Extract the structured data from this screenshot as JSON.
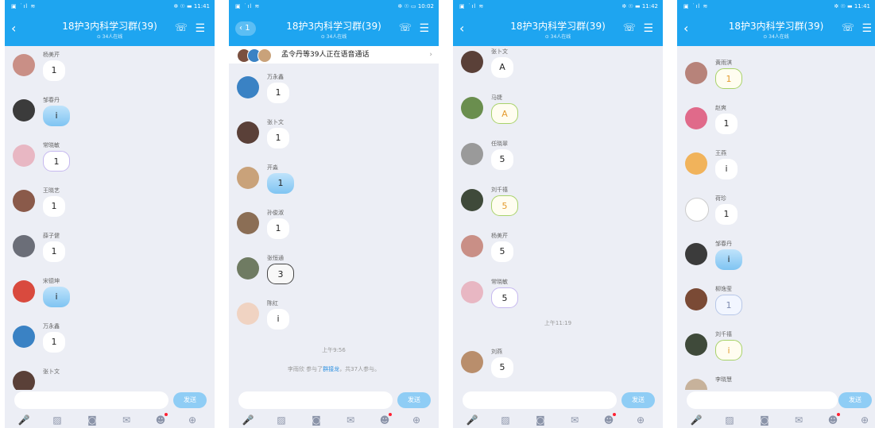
{
  "colors": {
    "header": "#1ea5f0",
    "bg": "#eceef5",
    "send": "#8fcdf5",
    "accent_link": "#2a8fe0"
  },
  "phones": [
    {
      "status_left": "▣ ˙ıl ≋",
      "status_right": "✲ ☉ ▬ 11:41",
      "back_label": "‹",
      "back_count": "",
      "title": "18护3内科学习群(39)",
      "subtitle": "⊙ 34人在线",
      "banner": null,
      "messages": [
        {
          "name": "杨美芹",
          "text": "1",
          "style": "plain",
          "avatar": "#c98f86"
        },
        {
          "name": "邹春丹",
          "text": "i",
          "style": "blue",
          "avatar": "#3b3b3b"
        },
        {
          "name": "常晓敏",
          "text": "1",
          "style": "purple",
          "avatar": "#e8b7c3"
        },
        {
          "name": "王晓艺",
          "text": "1",
          "style": "plain",
          "avatar": "#8a5a4a"
        },
        {
          "name": "薛子健",
          "text": "1",
          "style": "plain",
          "avatar": "#6b6e78"
        },
        {
          "name": "宋德坤",
          "text": "i",
          "style": "blue",
          "avatar": "#d94a3e"
        },
        {
          "name": "万永鑫",
          "text": "1",
          "style": "plain",
          "avatar": "#3a82c4"
        },
        {
          "name": "张卜文",
          "text": "",
          "style": "none",
          "avatar": "#5a4038"
        }
      ],
      "system": [],
      "send_label": "发送"
    },
    {
      "status_left": "▣ ˙ıl ≋",
      "status_right": "✲ ☉ ▭ 10:02",
      "back_label": "‹",
      "back_count": "1",
      "title": "18护3内科学习群(39)",
      "subtitle": "⊙ 34人在线",
      "banner": {
        "text": "孟令丹等39人正在语音通话",
        "chevron": "›"
      },
      "messages": [
        {
          "name": "万永鑫",
          "text": "1",
          "style": "plain",
          "avatar": "#3a82c4"
        },
        {
          "name": "张卜文",
          "text": "1",
          "style": "plain",
          "avatar": "#5a4038"
        },
        {
          "name": "开淼",
          "text": "1",
          "style": "blue",
          "avatar": "#c9a27a"
        },
        {
          "name": "孙俊淑",
          "text": "1",
          "style": "plain",
          "avatar": "#8b6e55"
        },
        {
          "name": "张恒通",
          "text": "3",
          "style": "dark",
          "avatar": "#6f7b62"
        },
        {
          "name": "陈红",
          "text": "i",
          "style": "plain",
          "avatar": "#f0d3c2"
        }
      ],
      "system": [
        {
          "text": "上午9:56"
        },
        {
          "text_before": "李雨欣 参与了",
          "link": "群接龙",
          "text_after": "，共37人参与。"
        }
      ],
      "send_label": "发送"
    },
    {
      "status_left": "▣ ˙ıl ≋",
      "status_right": "✲ ☉ ▬ 11:42",
      "back_label": "‹",
      "back_count": "",
      "title": "18护3内科学习群(39)",
      "subtitle": "⊙ 34人在线",
      "banner": null,
      "messages": [
        {
          "name": "张卜文",
          "text": "A",
          "style": "plain",
          "avatar": "#5a4038"
        },
        {
          "name": "马婕",
          "text": "A",
          "style": "frame",
          "avatar": "#6a8e4e"
        },
        {
          "name": "任晓翠",
          "text": "5",
          "style": "plain",
          "avatar": "#9a9a9a"
        },
        {
          "name": "刘千禧",
          "text": "5",
          "style": "frame",
          "avatar": "#3f4a3a"
        },
        {
          "name": "杨美芹",
          "text": "5",
          "style": "plain",
          "avatar": "#c98f86"
        },
        {
          "name": "常晓敏",
          "text": "5",
          "style": "purple",
          "avatar": "#e8b7c3"
        },
        {
          "name": "刘燕",
          "text": "5",
          "style": "plain",
          "avatar": "#b98e6c"
        }
      ],
      "system": [
        {
          "text": "上午11:19"
        }
      ],
      "send_label": "发送"
    },
    {
      "status_left": "▣ ˙ıl ≋",
      "status_right": "✲ ☉ ▬ 11:41",
      "back_label": "‹",
      "back_count": "",
      "title": "18护3内科学习群(39)",
      "subtitle": "⊙ 34人在线",
      "banner": null,
      "messages": [
        {
          "name": "黄雨淇",
          "text": "1",
          "style": "frame",
          "avatar": "#b7837a"
        },
        {
          "name": "赵爽",
          "text": "1",
          "style": "plain",
          "avatar": "#e06a8a"
        },
        {
          "name": "王燕",
          "text": "i",
          "style": "plain",
          "avatar": "#f1b35b"
        },
        {
          "name": "荷珍",
          "text": "1",
          "style": "plain",
          "avatar": "#ffffff"
        },
        {
          "name": "邹春丹",
          "text": "i",
          "style": "blue",
          "avatar": "#3b3b3b"
        },
        {
          "name": "柳逸莹",
          "text": "1",
          "style": "cloud",
          "avatar": "#7a4a35"
        },
        {
          "name": "刘千禧",
          "text": "i",
          "style": "frame",
          "avatar": "#3f4a3a"
        },
        {
          "name": "李晓慧",
          "text": "",
          "style": "none",
          "avatar": "#c7b29b"
        }
      ],
      "system": [],
      "send_label": "发送"
    }
  ],
  "toolbar_icons": [
    "microphone-icon",
    "image-icon",
    "camera-icon",
    "red-packet-icon",
    "emoji-icon",
    "plus-icon"
  ],
  "toolbar_glyphs": [
    "🎤",
    "▨",
    "◙",
    "✉",
    "☻",
    "⊕"
  ]
}
